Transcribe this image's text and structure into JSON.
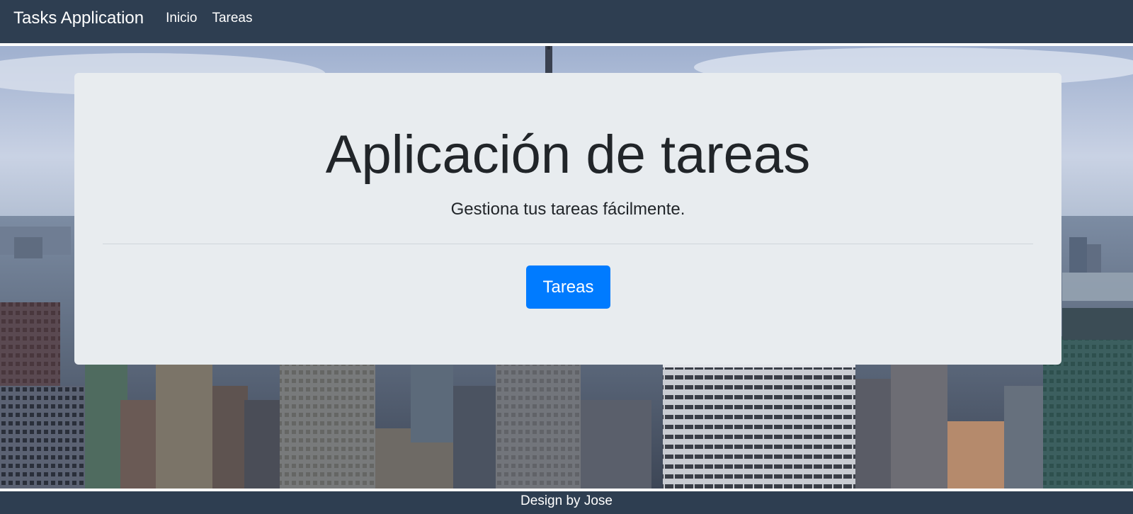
{
  "navbar": {
    "brand": "Tasks Application",
    "links": [
      "Inicio",
      "Tareas"
    ]
  },
  "jumbotron": {
    "title": "Aplicación de tareas",
    "lead": "Gestiona tus tareas fácilmente.",
    "button_label": "Tareas"
  },
  "footer": {
    "text": "Design by Jose"
  },
  "colors": {
    "navbar_bg": "#2e3e51",
    "jumbotron_bg": "#e8ecef",
    "primary_button": "#007bff",
    "text_dark": "#212529"
  }
}
